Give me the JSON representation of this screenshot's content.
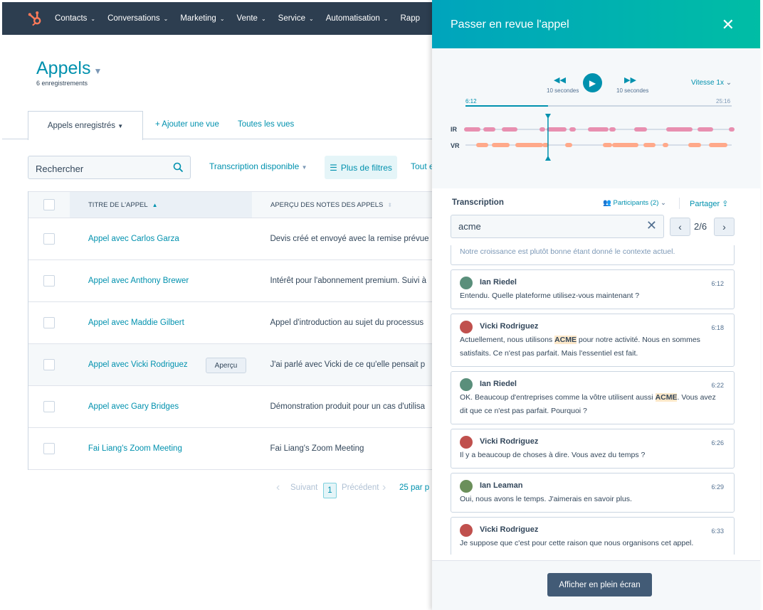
{
  "nav": {
    "items": [
      "Contacts",
      "Conversations",
      "Marketing",
      "Vente",
      "Service",
      "Automatisation",
      "Rapp"
    ]
  },
  "page": {
    "title": "Appels",
    "subtitle": "6 enregistrements"
  },
  "views": {
    "active": "Appels enregistrés",
    "add": "Ajouter une vue",
    "all": "Toutes les vues"
  },
  "filters": {
    "search_placeholder": "Rechercher",
    "transcription": "Transcription disponible",
    "more": "Plus de filtres",
    "all": "Tout e"
  },
  "table": {
    "headers": [
      "TITRE DE L'APPEL",
      "APERÇU DES NOTES DES APPELS"
    ],
    "rows": [
      {
        "title": "Appel avec Carlos Garza",
        "notes": "Devis créé et envoyé avec la remise prévue"
      },
      {
        "title": "Appel avec Anthony Brewer",
        "notes": "Intérêt pour l'abonnement premium. Suivi à"
      },
      {
        "title": "Appel avec Maddie Gilbert",
        "notes": "Appel d'introduction au sujet du processus"
      },
      {
        "title": "Appel avec Vicki Rodriguez",
        "notes": "J'ai parlé avec Vicki de ce qu'elle pensait p",
        "preview": "Aperçu"
      },
      {
        "title": "Appel avec Gary Bridges",
        "notes": "Démonstration produit pour un cas d'utilisa"
      },
      {
        "title": "Fai Liang's Zoom Meeting",
        "notes": "Fai Liang's Zoom Meeting"
      }
    ]
  },
  "pagination": {
    "next": "Suivant",
    "page": "1",
    "prev": "Précédent",
    "per_page": "25 par p"
  },
  "panel": {
    "title": "Passer en revue l'appel",
    "player": {
      "back": "10 secondes",
      "forward": "10 secondes",
      "speed": "Vitesse 1x",
      "current": "6:12",
      "duration": "25:16",
      "progress_fraction": 0.245,
      "tracks": [
        "IR",
        "VR"
      ]
    },
    "transcript": {
      "label": "Transcription",
      "participants": "Participants (2)",
      "share": "Partager",
      "search": "acme",
      "match": "2/6",
      "prev_line": "Notre croissance est plutôt bonne étant donné le contexte actuel.",
      "messages": [
        {
          "name": "Ian Riedel",
          "time": "6:12",
          "parts": [
            "Entendu. Quelle plateforme utilisez-vous maintenant ?"
          ]
        },
        {
          "name": "Vicki Rodriguez",
          "time": "6:18",
          "parts": [
            "Actuellement, nous utilisons ",
            "ACME",
            " pour notre activité. Nous en sommes satisfaits. Ce n'est pas parfait. Mais l'essentiel est fait."
          ]
        },
        {
          "name": "Ian Riedel",
          "time": "6:22",
          "parts": [
            "OK. Beaucoup d'entreprises comme la vôtre utilisent aussi ",
            "ACME",
            ". Vous avez dit que ce n'est pas parfait. Pourquoi ?"
          ]
        },
        {
          "name": "Vicki Rodriguez",
          "time": "6:26",
          "parts": [
            "Il y a beaucoup de choses à dire. Vous avez du temps ?"
          ]
        },
        {
          "name": "Ian Leaman",
          "time": "6:29",
          "parts": [
            "Oui, nous avons le temps. J'aimerais en savoir plus."
          ]
        },
        {
          "name": "Vicki Rodriguez",
          "time": "6:33",
          "parts": [
            "Je suppose que c'est pour cette raison que nous organisons cet appel."
          ]
        }
      ]
    },
    "fullscreen": "Afficher en plein écran"
  },
  "colors": {
    "accent": "#0091ae",
    "nav": "#2d3e50",
    "ir": "#e88fb0",
    "vr": "#ffa98a",
    "highlight": "#fde8c9"
  }
}
